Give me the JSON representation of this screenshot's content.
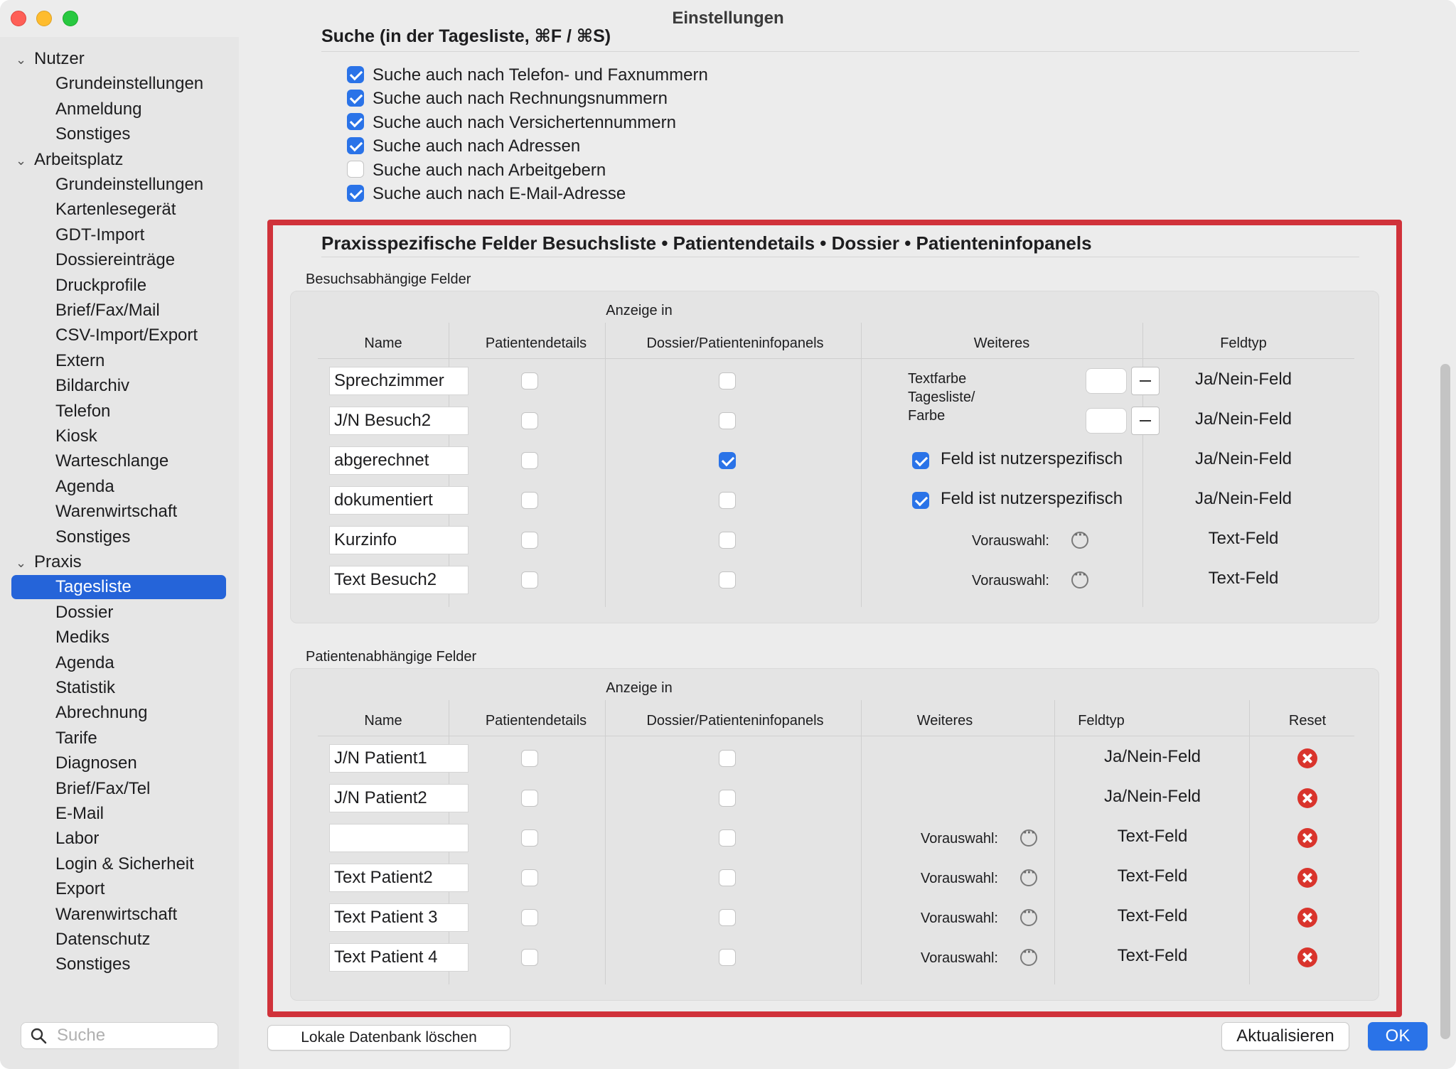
{
  "window": {
    "title": "Einstellungen"
  },
  "sidebar": {
    "items": [
      {
        "label": "Nutzer",
        "type": "group"
      },
      {
        "label": "Grundeinstellungen",
        "type": "child"
      },
      {
        "label": "Anmeldung",
        "type": "child"
      },
      {
        "label": "Sonstiges",
        "type": "child"
      },
      {
        "label": "Arbeitsplatz",
        "type": "group"
      },
      {
        "label": "Grundeinstellungen",
        "type": "child"
      },
      {
        "label": "Kartenlesegerät",
        "type": "child"
      },
      {
        "label": "GDT-Import",
        "type": "child"
      },
      {
        "label": "Dossiereinträge",
        "type": "child"
      },
      {
        "label": "Druckprofile",
        "type": "child"
      },
      {
        "label": "Brief/Fax/Mail",
        "type": "child"
      },
      {
        "label": "CSV-Import/Export",
        "type": "child"
      },
      {
        "label": "Extern",
        "type": "child"
      },
      {
        "label": "Bildarchiv",
        "type": "child"
      },
      {
        "label": "Telefon",
        "type": "child"
      },
      {
        "label": "Kiosk",
        "type": "child"
      },
      {
        "label": "Warteschlange",
        "type": "child"
      },
      {
        "label": "Agenda",
        "type": "child"
      },
      {
        "label": "Warenwirtschaft",
        "type": "child"
      },
      {
        "label": "Sonstiges",
        "type": "child"
      },
      {
        "label": "Praxis",
        "type": "group"
      },
      {
        "label": "Tagesliste",
        "type": "child",
        "active": true
      },
      {
        "label": "Dossier",
        "type": "child"
      },
      {
        "label": "Mediks",
        "type": "child"
      },
      {
        "label": "Agenda",
        "type": "child"
      },
      {
        "label": "Statistik",
        "type": "child"
      },
      {
        "label": "Abrechnung",
        "type": "child"
      },
      {
        "label": "Tarife",
        "type": "child"
      },
      {
        "label": "Diagnosen",
        "type": "child"
      },
      {
        "label": "Brief/Fax/Tel",
        "type": "child"
      },
      {
        "label": "E-Mail",
        "type": "child"
      },
      {
        "label": "Labor",
        "type": "child"
      },
      {
        "label": "Login & Sicherheit",
        "type": "child"
      },
      {
        "label": "Export",
        "type": "child"
      },
      {
        "label": "Warenwirtschaft",
        "type": "child"
      },
      {
        "label": "Datenschutz",
        "type": "child"
      },
      {
        "label": "Sonstiges",
        "type": "child"
      }
    ],
    "search": {
      "placeholder": "Suche",
      "value": ""
    }
  },
  "search_section": {
    "title": "Suche (in der Tagesliste, ⌘F / ⌘S)",
    "options": [
      {
        "label": "Suche auch nach Telefon- und Faxnummern",
        "checked": true
      },
      {
        "label": "Suche auch nach Rechnungsnummern",
        "checked": true
      },
      {
        "label": "Suche auch nach Versichertennummern",
        "checked": true
      },
      {
        "label": "Suche auch nach Adressen",
        "checked": true
      },
      {
        "label": "Suche auch nach Arbeitgebern",
        "checked": false
      },
      {
        "label": "Suche auch nach E-Mail-Adresse",
        "checked": true
      }
    ]
  },
  "custom_fields": {
    "title": "Praxisspezifische Felder Besuchsliste • Patientendetails • Dossier • Patienteninfopanels",
    "visit": {
      "label": "Besuchsabhängige Felder",
      "headers": {
        "anzeige_in": "Anzeige in",
        "name": "Name",
        "patientendetails": "Patientendetails",
        "dossier": "Dossier/Patienteninfopanels",
        "weiteres": "Weiteres",
        "feldtyp": "Feldtyp"
      },
      "weiteres_color_label": "Textfarbe Tagesliste/ Farbe",
      "weiteres_color_label_lines": [
        "Textfarbe",
        "Tagesliste/",
        "Farbe"
      ],
      "rows": [
        {
          "name": "Sprechzimmer",
          "patientendetails": false,
          "dossier": false,
          "weiteres": "color",
          "feldtyp": "Ja/Nein-Feld"
        },
        {
          "name": "J/N Besuch2",
          "patientendetails": false,
          "dossier": false,
          "weiteres": "color",
          "feldtyp": "Ja/Nein-Feld"
        },
        {
          "name": "abgerechnet",
          "patientendetails": false,
          "dossier": true,
          "weiteres": "user",
          "weiteres_checked": true,
          "weiteres_label": "Feld ist nutzerspezifisch",
          "feldtyp": "Ja/Nein-Feld"
        },
        {
          "name": "dokumentiert",
          "patientendetails": false,
          "dossier": false,
          "weiteres": "user",
          "weiteres_checked": true,
          "weiteres_label": "Feld ist nutzerspezifisch",
          "feldtyp": "Ja/Nein-Feld"
        },
        {
          "name": "Kurzinfo",
          "patientendetails": false,
          "dossier": false,
          "weiteres": "preselect",
          "weiteres_label": "Vorauswahl:",
          "feldtyp": "Text-Feld"
        },
        {
          "name": "Text Besuch2",
          "patientendetails": false,
          "dossier": false,
          "weiteres": "preselect",
          "weiteres_label": "Vorauswahl:",
          "feldtyp": "Text-Feld"
        }
      ]
    },
    "patient": {
      "label": "Patientenabhängige Felder",
      "headers": {
        "anzeige_in": "Anzeige in",
        "name": "Name",
        "patientendetails": "Patientendetails",
        "dossier": "Dossier/Patienteninfopanels",
        "weiteres": "Weiteres",
        "feldtyp": "Feldtyp",
        "reset": "Reset"
      },
      "rows": [
        {
          "name": "J/N Patient1",
          "patientendetails": false,
          "dossier": false,
          "weiteres": "",
          "feldtyp": "Ja/Nein-Feld"
        },
        {
          "name": "J/N Patient2",
          "patientendetails": false,
          "dossier": false,
          "weiteres": "",
          "feldtyp": "Ja/Nein-Feld"
        },
        {
          "name": "",
          "patientendetails": false,
          "dossier": false,
          "weiteres": "Vorauswahl:",
          "feldtyp": "Text-Feld"
        },
        {
          "name": "Text Patient2",
          "patientendetails": false,
          "dossier": false,
          "weiteres": "Vorauswahl:",
          "feldtyp": "Text-Feld"
        },
        {
          "name": "Text Patient 3",
          "patientendetails": false,
          "dossier": false,
          "weiteres": "Vorauswahl:",
          "feldtyp": "Text-Feld"
        },
        {
          "name": "Text Patient 4",
          "patientendetails": false,
          "dossier": false,
          "weiteres": "Vorauswahl:",
          "feldtyp": "Text-Feld"
        }
      ]
    }
  },
  "footer": {
    "delete_db": "Lokale Datenbank löschen",
    "update": "Aktualisieren",
    "ok": "OK"
  },
  "colors": {
    "accent": "#2a73e8",
    "sidebar_selection": "#2564d9",
    "highlight_frame": "#d0323a",
    "reset": "#d9342c"
  }
}
